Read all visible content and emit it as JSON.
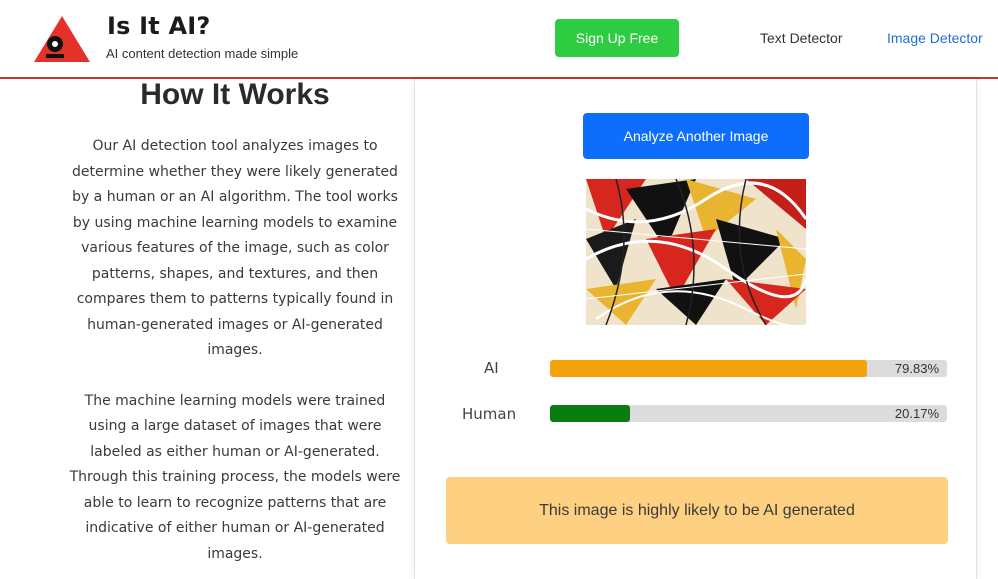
{
  "header": {
    "brand_title": "Is It AI?",
    "brand_tagline": "AI content detection made simple",
    "signup_label": "Sign Up Free",
    "nav": [
      {
        "label": "Text Detector"
      },
      {
        "label": "Image Detector"
      }
    ]
  },
  "how_it_works": {
    "title": "How It Works",
    "paragraph1": "Our AI detection tool analyzes images to determine whether they were likely generated by a human or an AI algorithm. The tool works by using machine learning models to examine various features of the image, such as color patterns, shapes, and textures, and then compares them to patterns typically found in human-generated images or AI-generated images.",
    "paragraph2": "The machine learning models were trained using a large dataset of images that were labeled as either human or AI-generated. Through this training process, the models were able to learn to recognize patterns that are indicative of either human or AI-generated images."
  },
  "result": {
    "analyze_label": "Analyze Another Image",
    "bars": [
      {
        "label": "AI",
        "percent_text": "79.83%",
        "value": 79.83,
        "color": "#f5a30a"
      },
      {
        "label": "Human",
        "percent_text": "20.17%",
        "value": 20.17,
        "color": "#0a7d10"
      }
    ],
    "verdict": "This image is highly likely to be AI generated"
  },
  "colors": {
    "accent_green": "#2ecc40",
    "accent_blue": "#0d6efd",
    "header_rule": "#c0392b",
    "verdict_bg": "#fed082"
  },
  "icons": {
    "logo": "red-triangle-robot-logo-icon"
  }
}
